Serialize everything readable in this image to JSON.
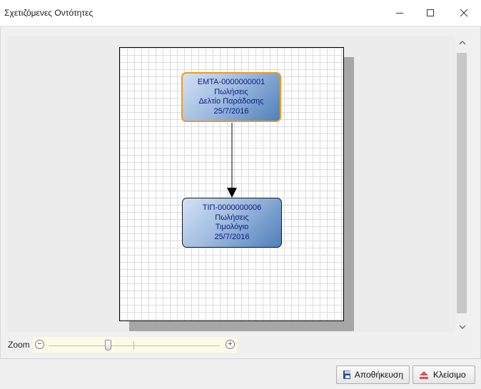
{
  "window": {
    "title": "Σχετιζόμενες Οντότητες",
    "minimize_glyph": "—",
    "maximize_glyph": "☐",
    "close_glyph": "✕"
  },
  "diagram": {
    "nodes": [
      {
        "code": "ΕΜΤΑ-0000000001",
        "category": "Πωλήσεις",
        "doc_type": "Δελτίο Παράδοσης",
        "date": "25/7/2016",
        "selected": true
      },
      {
        "code": "ΤΙΠ-0000000006",
        "category": "Πωλήσεις",
        "doc_type": "Τιμολόγιο",
        "date": "25/7/2016",
        "selected": false
      }
    ]
  },
  "scrollbar": {
    "up_glyph": "˄",
    "down_glyph": "˅"
  },
  "zoom": {
    "label": "Zoom",
    "minus_glyph": "−",
    "plus_glyph": "+",
    "level_fraction": 0.4
  },
  "footer": {
    "save_label": "Αποθήκευση",
    "close_label": "Κλείσιμο"
  },
  "icons": {
    "save": "save-icon",
    "close": "eject-icon"
  },
  "colors": {
    "selected_border": "#f39a1c",
    "node_text": "#0a1a80",
    "node_fill_light": "#d4e2f3",
    "node_fill_dark": "#4f7fb8"
  }
}
